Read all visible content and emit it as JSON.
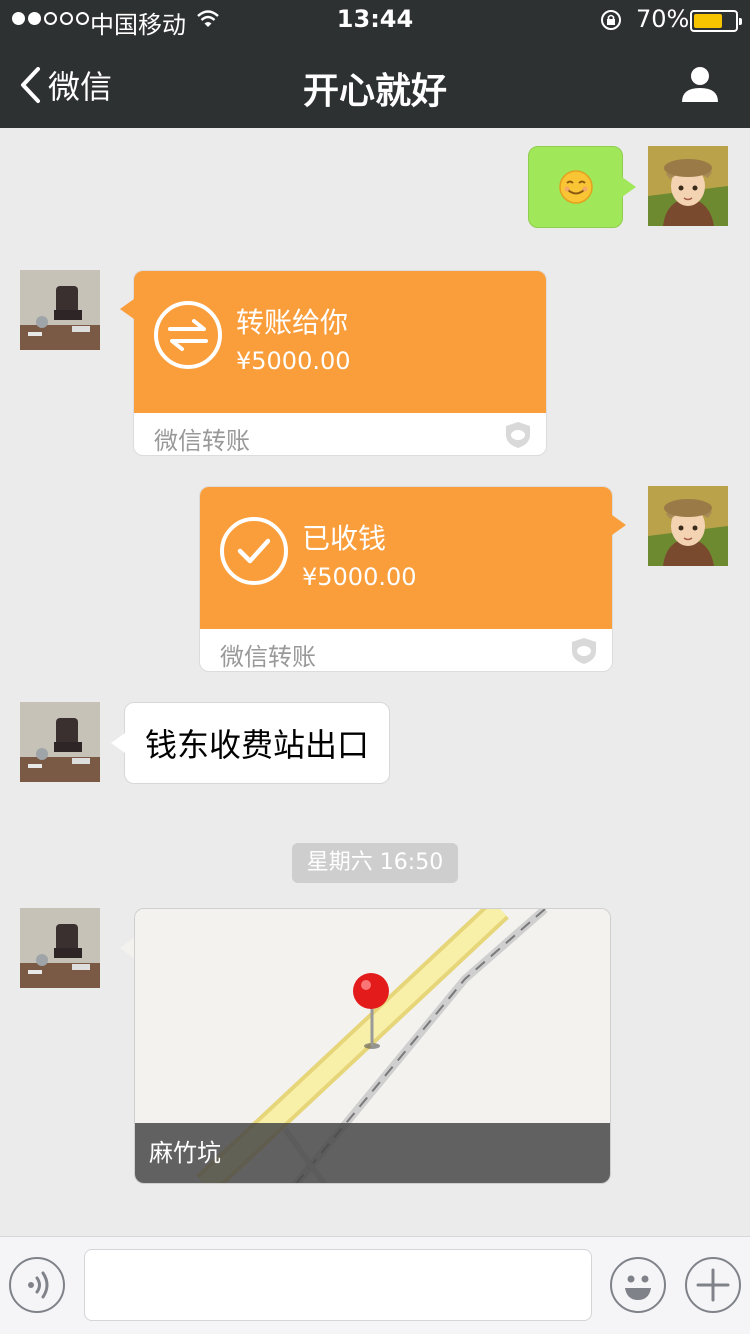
{
  "status_bar": {
    "carrier": "中国移动",
    "time": "13:44",
    "battery_percent": "70%",
    "battery_level": 0.7,
    "signal_strength": 2,
    "signal_total": 5
  },
  "nav": {
    "back_label": "微信",
    "title": "开心就好"
  },
  "messages": [
    {
      "type": "emoji",
      "side": "right",
      "emoji": "smiling-face"
    },
    {
      "type": "transfer",
      "side": "left",
      "title": "转账给你",
      "amount": "¥5000.00",
      "footer": "微信转账"
    },
    {
      "type": "transfer",
      "side": "right",
      "title": "已收钱",
      "amount": "¥5000.00",
      "footer": "微信转账"
    },
    {
      "type": "text",
      "side": "left",
      "text": "钱东收费站出口"
    },
    {
      "type": "timestamp",
      "text": "星期六 16:50"
    },
    {
      "type": "location",
      "side": "left",
      "place": "麻竹坑"
    }
  ],
  "input_bar": {
    "text_value": "",
    "icons": [
      "voice-icon",
      "emoji-icon",
      "plus-icon"
    ]
  },
  "colors": {
    "nav_bg": "#2e3132",
    "chat_bg": "#ebebeb",
    "sent_bubble": "#a0e75a",
    "transfer_orange": "#fa9d3b",
    "battery_yellow": "#f7c500"
  }
}
